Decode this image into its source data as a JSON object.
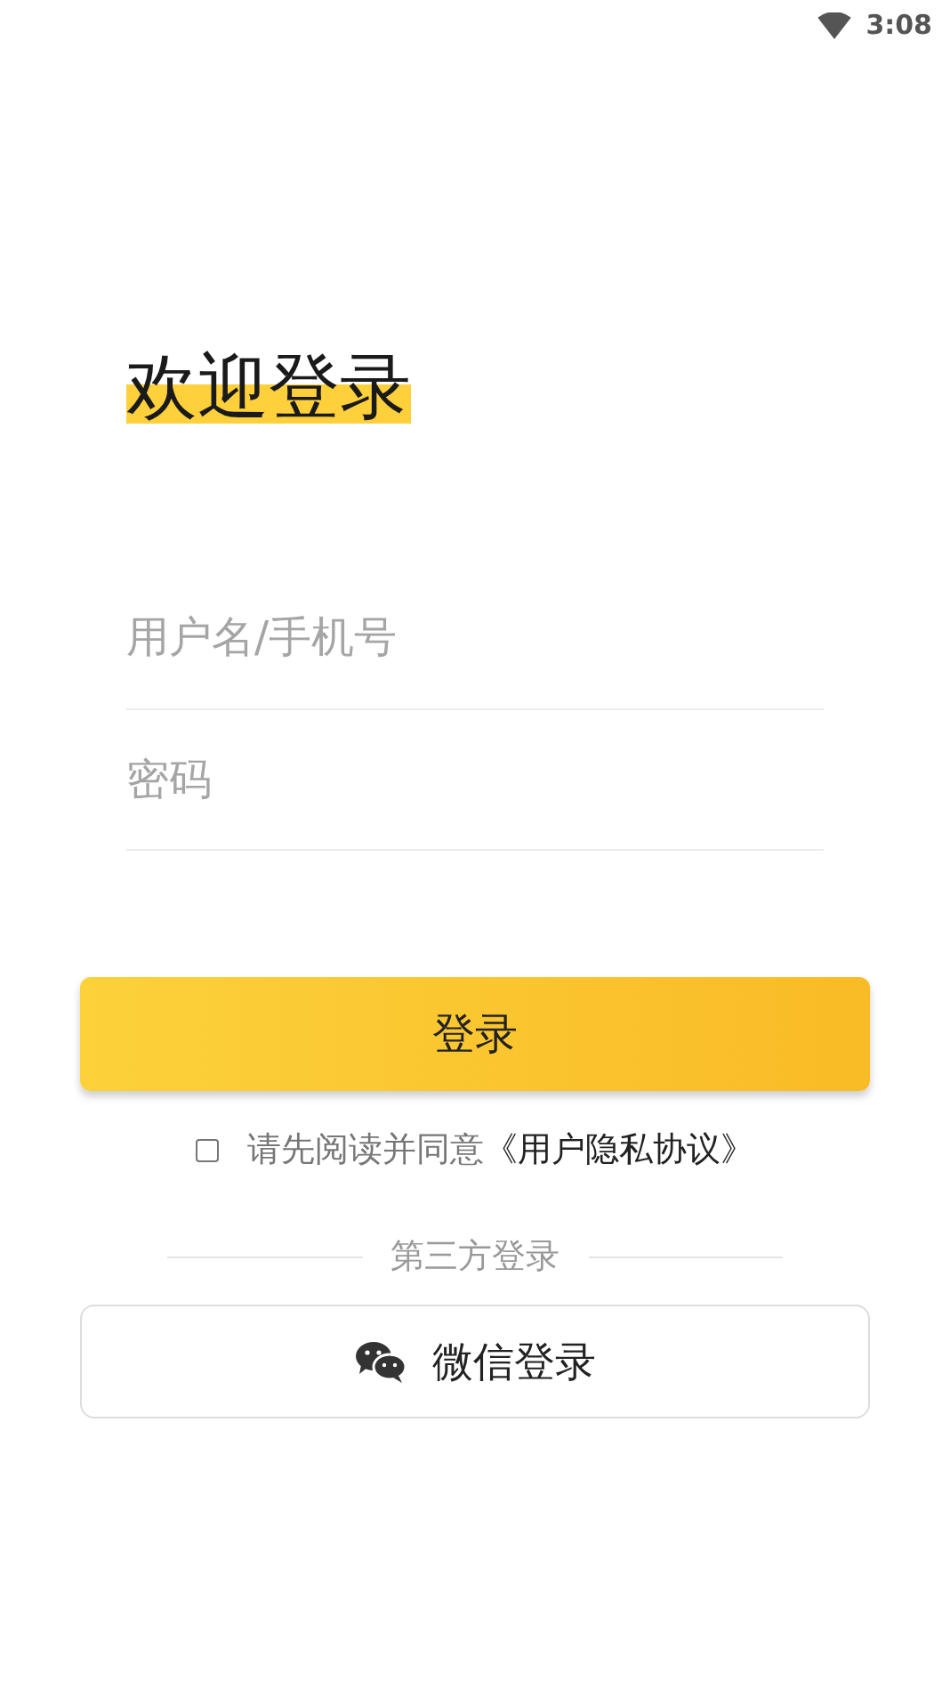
{
  "status_bar": {
    "time": "3:08"
  },
  "title": "欢迎登录",
  "fields": [
    {
      "placeholder": "用户名/手机号"
    },
    {
      "placeholder": "密码"
    }
  ],
  "login_button": "登录",
  "agreement": {
    "checked": false,
    "text": "请先阅读并同意",
    "link": "《用户隐私协议》"
  },
  "third_party": {
    "label": "第三方登录",
    "wechat_button": "微信登录"
  }
}
